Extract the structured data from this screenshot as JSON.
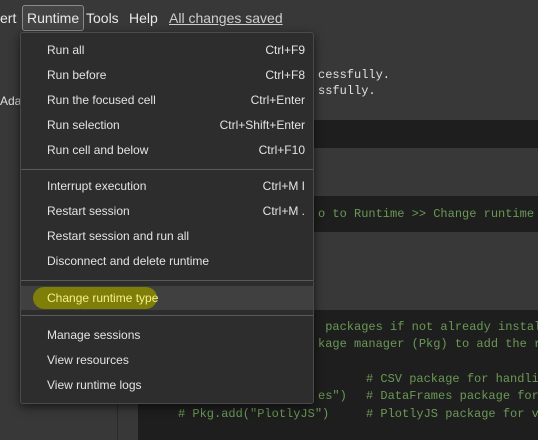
{
  "menubar": {
    "insert_partial": "ert",
    "runtime": "Runtime",
    "tools": "Tools",
    "help": "Help",
    "saved": "All changes saved"
  },
  "left_partial_text": "Adap",
  "code": {
    "line1": "cessfully.",
    "line2": "ssfully.",
    "comment_runtime": "o to Runtime >> Change runtime ty",
    "comment_pkg1": " packages if not already installe",
    "comment_pkg2": "kage manager (Pkg) to add the req",
    "comment_csv": "# CSV package for handlin",
    "es_close": "es\")",
    "comment_df": "# DataFrames package for",
    "pkg_plotly": "# Pkg.add(\"PlotlyJS\")",
    "comment_plotly": "# PlotlyJS package for vi"
  },
  "runtime_menu": {
    "items": [
      {
        "label": "Run all",
        "shortcut": "Ctrl+F9"
      },
      {
        "label": "Run before",
        "shortcut": "Ctrl+F8"
      },
      {
        "label": "Run the focused cell",
        "shortcut": "Ctrl+Enter"
      },
      {
        "label": "Run selection",
        "shortcut": "Ctrl+Shift+Enter"
      },
      {
        "label": "Run cell and below",
        "shortcut": "Ctrl+F10"
      },
      {
        "label": "Interrupt execution",
        "shortcut": "Ctrl+M I"
      },
      {
        "label": "Restart session",
        "shortcut": "Ctrl+M ."
      },
      {
        "label": "Restart session and run all",
        "shortcut": ""
      },
      {
        "label": "Disconnect and delete runtime",
        "shortcut": ""
      },
      {
        "label": "Change runtime type",
        "shortcut": ""
      },
      {
        "label": "Manage sessions",
        "shortcut": ""
      },
      {
        "label": "View resources",
        "shortcut": ""
      },
      {
        "label": "View runtime logs",
        "shortcut": ""
      }
    ]
  }
}
